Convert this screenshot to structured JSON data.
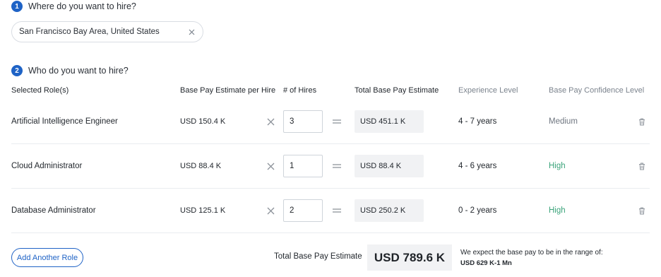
{
  "step1": {
    "number": "1",
    "title": "Where do you want to hire?",
    "location": "San Francisco Bay Area, United States"
  },
  "step2": {
    "number": "2",
    "title": "Who do you want to hire?"
  },
  "columns": {
    "role": "Selected Role(s)",
    "base_pay": "Base Pay Estimate per Hire",
    "hires": "# of Hires",
    "total": "Total Base Pay Estimate",
    "experience": "Experience Level",
    "confidence": "Base Pay Confidence Level"
  },
  "rows": [
    {
      "role": "Artificial Intelligence Engineer",
      "base_pay": "USD 150.4 K",
      "hires": "3",
      "total": "USD 451.1 K",
      "experience": "4 - 7 years",
      "confidence": "Medium",
      "confidence_color": "#6f7680"
    },
    {
      "role": "Cloud Administrator",
      "base_pay": "USD 88.4 K",
      "hires": "1",
      "total": "USD 88.4 K",
      "experience": "4 - 6 years",
      "confidence": "High",
      "confidence_color": "#3aa37a"
    },
    {
      "role": "Database Administrator",
      "base_pay": "USD 125.1 K",
      "hires": "2",
      "total": "USD 250.2 K",
      "experience": "0 - 2 years",
      "confidence": "High",
      "confidence_color": "#3aa37a"
    }
  ],
  "footer": {
    "add_role": "Add Another Role",
    "total_label": "Total Base Pay Estimate",
    "total_value": "USD 789.6 K",
    "range_text": "We expect the base pay to be in the range of:",
    "range_value": "USD 629 K-1 Mn"
  },
  "icons": {
    "step_badge": "numbered-circle",
    "chip_close": "close-icon",
    "multiply": "multiply-icon",
    "equals": "equals-icon",
    "delete": "trash-icon"
  },
  "colors": {
    "accent": "#1f63c6",
    "high": "#3aa37a",
    "medium": "#6f7680"
  }
}
